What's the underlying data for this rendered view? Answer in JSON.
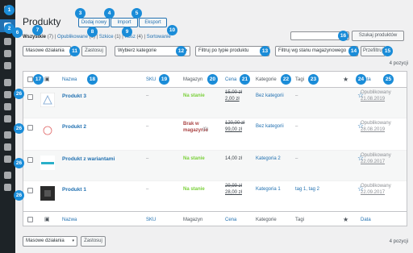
{
  "page": {
    "title": "Produkty",
    "add_new": "Dodaj nowy",
    "import": "Import",
    "export": "Eksport"
  },
  "filters": {
    "all": "Wszystkie",
    "all_count": "(7)",
    "published": "Opublikowane",
    "published_count": "(6)",
    "drafts": "Szkice",
    "drafts_count": "(1)",
    "trash": "Kosz",
    "trash_count": "(4)",
    "sorting": "Sortowanie",
    "sep": "|"
  },
  "search": {
    "button": "Szukaj produktów"
  },
  "toolbar": {
    "bulk_actions": "Masowe działania",
    "apply": "Zastosuj",
    "category": "Wybierz kategorie",
    "product_type": "Filtruj po typie produktu",
    "stock_status": "Filtruj wg stanu magazynowego",
    "filter": "Przefiltruj",
    "count": "4 pozycji"
  },
  "columns": {
    "name": "Nazwa",
    "sku": "SKU",
    "stock": "Magazyn",
    "price": "Cena",
    "categories": "Kategorie",
    "tags": "Tagi",
    "date": "Data"
  },
  "badges": [
    "1",
    "2",
    "3",
    "4",
    "5",
    "6",
    "7",
    "8",
    "9",
    "10",
    "11",
    "12",
    "13",
    "14",
    "15",
    "16",
    "17",
    "18",
    "19",
    "20",
    "21",
    "22",
    "23",
    "24",
    "25",
    "26",
    "26",
    "26",
    "26"
  ],
  "products": [
    {
      "name": "Produkt 3",
      "sku": "–",
      "stock": "Na stanie",
      "price_old": "15,00 zł",
      "price_new": "2,00 zł",
      "category": "Bez kategorii",
      "tags": "–",
      "status": "Opublikowany",
      "date": "21.08.2019"
    },
    {
      "name": "Produkt 2",
      "sku": "–",
      "stock": "Brak w magazynie",
      "stock_count": "(0)",
      "price_old": "120,00 zł",
      "price_new": "99,00 zł",
      "category": "Bez kategorii",
      "tags": "–",
      "status": "Opublikowany",
      "date": "28.08.2019"
    },
    {
      "name": "Produkt z wariantami",
      "sku": "–",
      "stock": "Na stanie",
      "price": "14,00 zł",
      "category": "Kategoria 2",
      "tags": "–",
      "status": "Opublikowany",
      "date": "22.09.2017"
    },
    {
      "name": "Produkt 1",
      "sku": "–",
      "stock": "Na stanie",
      "price_old": "29,99 zł",
      "price_new": "28,00 zł",
      "category": "Kategoria 1",
      "tags": "tag 1, tag 2",
      "status": "Opublikowany",
      "date": "22.09.2017"
    }
  ],
  "icons": {
    "star": "☆",
    "star_filled": "★",
    "caret": "▾"
  },
  "colors": {
    "accent": "#2271b1",
    "badge": "#1a8cd8",
    "instock": "#7ad03a",
    "outstock": "#aa4444",
    "sidebar": "#1d2327"
  }
}
